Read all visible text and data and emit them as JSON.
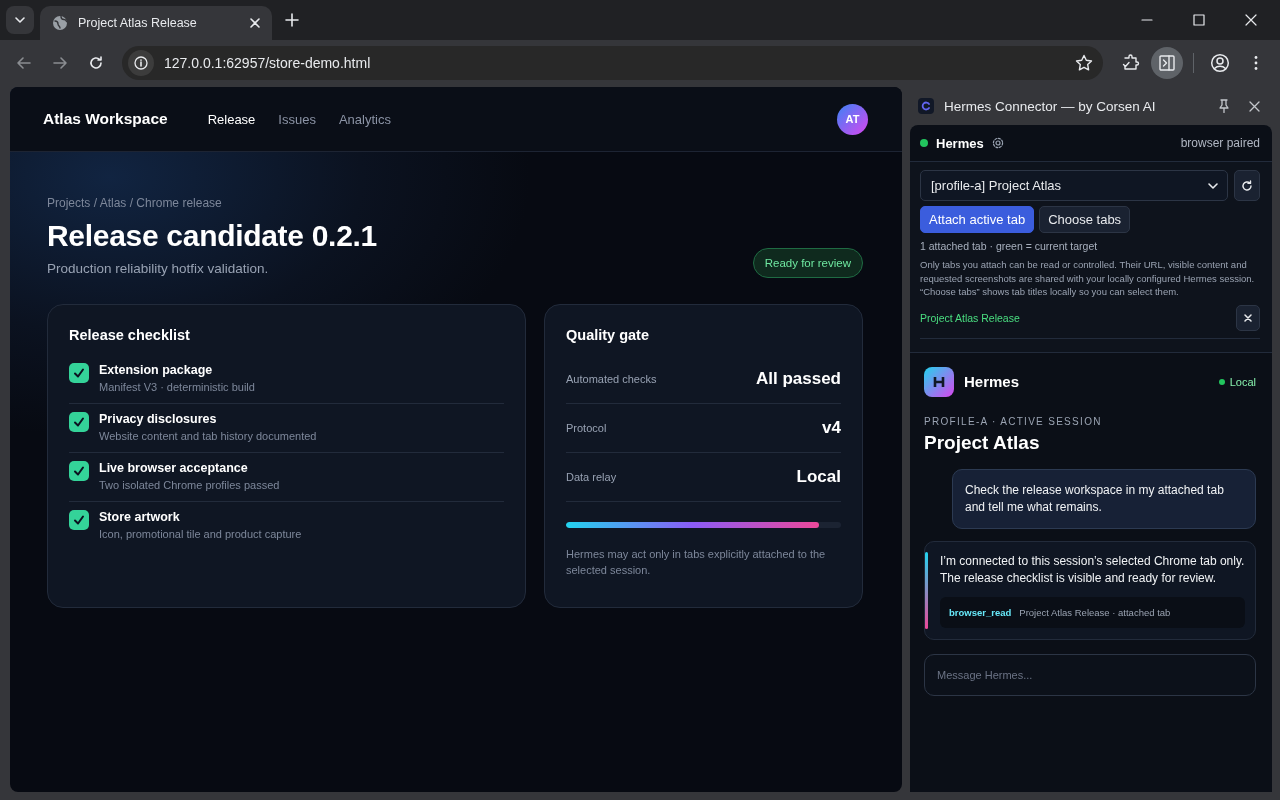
{
  "browser": {
    "tabs": [
      {
        "title": "Project Atlas Release",
        "selected": true
      }
    ],
    "address": "127.0.0.1:62957/store-demo.html",
    "side_panel_open": true
  },
  "page": {
    "brand": "Atlas Workspace",
    "nav": [
      {
        "label": "Release",
        "selected": true
      },
      {
        "label": "Issues",
        "selected": false
      },
      {
        "label": "Analytics",
        "selected": false
      }
    ],
    "avatar": "AT",
    "breadcrumb": "Projects / Atlas / Chrome release",
    "title": "Release candidate 0.2.1",
    "subtitle": "Production reliability hotfix validation.",
    "status_badge": "Ready for review",
    "checklist": {
      "title": "Release checklist",
      "items": [
        {
          "title": "Extension package",
          "detail": "Manifest V3 · deterministic build",
          "checked": true
        },
        {
          "title": "Privacy disclosures",
          "detail": "Website content and tab history documented",
          "checked": true
        },
        {
          "title": "Live browser acceptance",
          "detail": "Two isolated Chrome profiles passed",
          "checked": true
        },
        {
          "title": "Store artwork",
          "detail": "Icon, promotional tile and product capture",
          "checked": true
        }
      ]
    },
    "quality_gate": {
      "title": "Quality gate",
      "rows": [
        {
          "label": "Automated checks",
          "value": "All passed"
        },
        {
          "label": "Protocol",
          "value": "v4"
        },
        {
          "label": "Data relay",
          "value": "Local"
        }
      ],
      "level": 0.92,
      "note": "Hermes may act only in tabs explicitly attached to the selected session."
    }
  },
  "side_panel": {
    "title": "Hermes Connector — by Corsen AI",
    "connection": {
      "name": "Hermes",
      "connected": true,
      "status": "browser paired"
    },
    "session_select": "[profile-a] Project Atlas",
    "buttons": [
      {
        "label": "Attach active tab",
        "primary": true
      },
      {
        "label": "Choose tabs",
        "primary": false
      }
    ],
    "attached_summary": "1 attached tab · green = current target",
    "disclosure": "Only tabs you attach can be read or controlled. Their URL, visible content and requested screenshots are shared with your locally configured Hermes session. “Choose tabs” shows tab titles locally so you can select them.",
    "attached_tabs": [
      {
        "title": "Project Atlas Release",
        "current": true
      }
    ],
    "chat": {
      "name": "Hermes",
      "status": "Local",
      "eyebrow": "PROFILE-A · ACTIVE SESSION",
      "session_title": "Project Atlas",
      "messages": [
        {
          "kind": "user",
          "text": "Check the release workspace in my attached tab and tell me what remains."
        },
        {
          "kind": "assistant",
          "text": "I’m connected to this session’s selected Chrome tab only. The release checklist is visible and ready for review.",
          "tool": {
            "name": "browser_read",
            "detail": "Project Atlas Release · attached tab"
          }
        }
      ],
      "input_placeholder": "Message Hermes..."
    }
  }
}
